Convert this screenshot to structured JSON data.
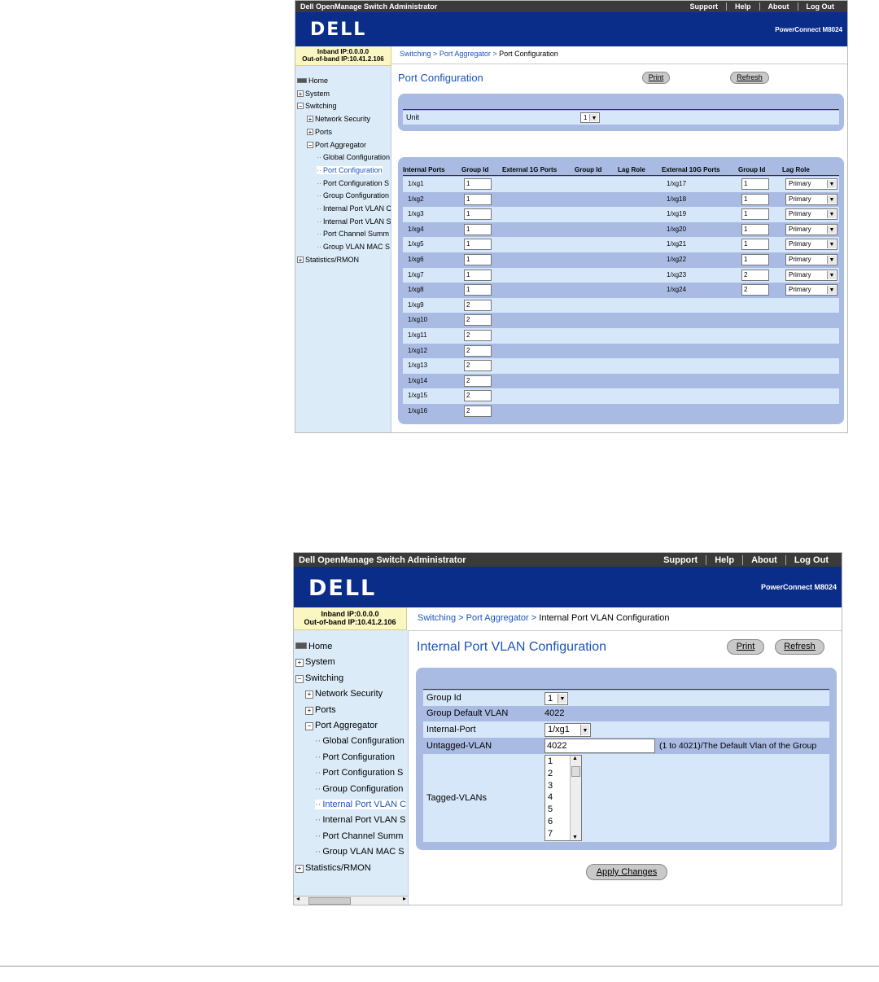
{
  "common": {
    "app_title": "Dell OpenManage Switch Administrator",
    "top_links": [
      "Support",
      "Help",
      "About",
      "Log Out"
    ],
    "logo": "DELL",
    "model": "PowerConnect M8024",
    "inband_ip": "Inband IP:0.0.0.0",
    "outband_ip": "Out-of-band IP:10.41.2.106",
    "print_label": "Print",
    "refresh_label": "Refresh",
    "breadcrumb_switching": "Switching",
    "breadcrumb_sep": ">",
    "breadcrumb_port_aggregator": "Port Aggregator"
  },
  "sidebar_one": [
    {
      "label": "Home",
      "level": 0,
      "icon": "home-icon",
      "selected": false
    },
    {
      "label": "System",
      "level": 0,
      "icon": "plus-icon",
      "selected": false
    },
    {
      "label": "Switching",
      "level": 0,
      "icon": "minus-icon",
      "selected": false
    },
    {
      "label": "Network Security",
      "level": 1,
      "icon": "plus-icon",
      "selected": false
    },
    {
      "label": "Ports",
      "level": 1,
      "icon": "plus-icon",
      "selected": false
    },
    {
      "label": "Port Aggregator",
      "level": 1,
      "icon": "minus-icon",
      "selected": false
    },
    {
      "label": "Global Configuration",
      "level": 2,
      "icon": "",
      "selected": false
    },
    {
      "label": "Port Configuration",
      "level": 2,
      "icon": "",
      "selected": true
    },
    {
      "label": "Port Configuration S",
      "level": 2,
      "icon": "",
      "selected": false
    },
    {
      "label": "Group Configuration",
      "level": 2,
      "icon": "",
      "selected": false
    },
    {
      "label": "Internal Port VLAN C",
      "level": 2,
      "icon": "",
      "selected": false
    },
    {
      "label": "Internal Port VLAN S",
      "level": 2,
      "icon": "",
      "selected": false
    },
    {
      "label": "Port Channel Summ",
      "level": 2,
      "icon": "",
      "selected": false
    },
    {
      "label": "Group VLAN MAC S",
      "level": 2,
      "icon": "",
      "selected": false
    },
    {
      "label": "Statistics/RMON",
      "level": 0,
      "icon": "plus-icon",
      "selected": false
    }
  ],
  "sidebar_two": [
    {
      "label": "Home",
      "level": 0,
      "icon": "home-icon",
      "selected": false
    },
    {
      "label": "System",
      "level": 0,
      "icon": "plus-icon",
      "selected": false
    },
    {
      "label": "Switching",
      "level": 0,
      "icon": "minus-icon",
      "selected": false
    },
    {
      "label": "Network Security",
      "level": 1,
      "icon": "plus-icon",
      "selected": false
    },
    {
      "label": "Ports",
      "level": 1,
      "icon": "plus-icon",
      "selected": false
    },
    {
      "label": "Port Aggregator",
      "level": 1,
      "icon": "minus-icon",
      "selected": false
    },
    {
      "label": "Global Configuration",
      "level": 2,
      "icon": "",
      "selected": false
    },
    {
      "label": "Port Configuration",
      "level": 2,
      "icon": "",
      "selected": false
    },
    {
      "label": "Port Configuration S",
      "level": 2,
      "icon": "",
      "selected": false
    },
    {
      "label": "Group Configuration",
      "level": 2,
      "icon": "",
      "selected": false
    },
    {
      "label": "Internal Port VLAN C",
      "level": 2,
      "icon": "",
      "selected": true
    },
    {
      "label": "Internal Port VLAN S",
      "level": 2,
      "icon": "",
      "selected": false
    },
    {
      "label": "Port Channel Summ",
      "level": 2,
      "icon": "",
      "selected": false
    },
    {
      "label": "Group VLAN MAC S",
      "level": 2,
      "icon": "",
      "selected": false
    },
    {
      "label": "Statistics/RMON",
      "level": 0,
      "icon": "plus-icon",
      "selected": false
    }
  ],
  "screen_one": {
    "breadcrumb_page": "Port Configuration",
    "title": "Port Configuration",
    "unit_label": "Unit",
    "unit_value": "1",
    "headers": {
      "internal_ports": "Internal Ports",
      "group_id": "Group Id",
      "external_1g": "External 1G Ports",
      "group_id_1g": "Group Id",
      "lag_role_1g": "Lag Role",
      "external_10g": "External 10G Ports",
      "group_id_10g": "Group Id",
      "lag_role_10g": "Lag Role"
    },
    "rows": [
      {
        "internal": "1/xg1",
        "group": "1",
        "external": "1/xg17",
        "ext_group": "1",
        "lag_role": "Primary"
      },
      {
        "internal": "1/xg2",
        "group": "1",
        "external": "1/xg18",
        "ext_group": "1",
        "lag_role": "Primary"
      },
      {
        "internal": "1/xg3",
        "group": "1",
        "external": "1/xg19",
        "ext_group": "1",
        "lag_role": "Primary"
      },
      {
        "internal": "1/xg4",
        "group": "1",
        "external": "1/xg20",
        "ext_group": "1",
        "lag_role": "Primary"
      },
      {
        "internal": "1/xg5",
        "group": "1",
        "external": "1/xg21",
        "ext_group": "1",
        "lag_role": "Primary"
      },
      {
        "internal": "1/xg6",
        "group": "1",
        "external": "1/xg22",
        "ext_group": "1",
        "lag_role": "Primary"
      },
      {
        "internal": "1/xg7",
        "group": "1",
        "external": "1/xg23",
        "ext_group": "2",
        "lag_role": "Primary"
      },
      {
        "internal": "1/xg8",
        "group": "1",
        "external": "1/xg24",
        "ext_group": "2",
        "lag_role": "Primary"
      },
      {
        "internal": "1/xg9",
        "group": "2"
      },
      {
        "internal": "1/xg10",
        "group": "2"
      },
      {
        "internal": "1/xg11",
        "group": "2"
      },
      {
        "internal": "1/xg12",
        "group": "2"
      },
      {
        "internal": "1/xg13",
        "group": "2"
      },
      {
        "internal": "1/xg14",
        "group": "2"
      },
      {
        "internal": "1/xg15",
        "group": "2"
      },
      {
        "internal": "1/xg16",
        "group": "2"
      }
    ]
  },
  "screen_two": {
    "breadcrumb_page": "Internal Port VLAN Configuration",
    "title": "Internal Port VLAN Configuration",
    "group_id_label": "Group Id",
    "group_id_value": "1",
    "group_default_vlan_label": "Group Default VLAN",
    "group_default_vlan_value": "4022",
    "internal_port_label": "Internal-Port",
    "internal_port_value": "1/xg1",
    "untagged_vlan_label": "Untagged-VLAN",
    "untagged_vlan_value": "4022",
    "untagged_vlan_hint": "(1 to 4021)/The Default Vlan of the Group",
    "tagged_vlans_label": "Tagged-VLANs",
    "tagged_vlans_options": [
      "1",
      "2",
      "3",
      "4",
      "5",
      "6",
      "7"
    ],
    "apply_label": "Apply Changes"
  }
}
